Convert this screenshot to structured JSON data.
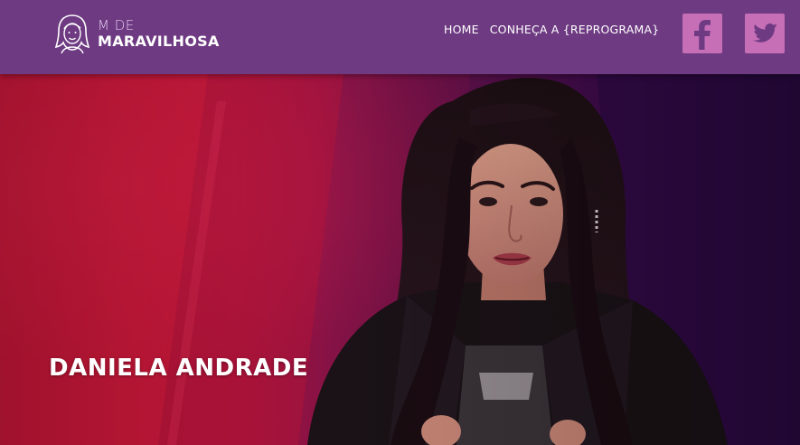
{
  "brand": {
    "line1": "M DE",
    "line2": "MARAVILHOSA",
    "logo_icon": "woman-face-logo-icon"
  },
  "nav": {
    "items": [
      {
        "label": "HOME"
      },
      {
        "label": "CONHEÇA A {REPROGRAMA}"
      }
    ]
  },
  "social": {
    "facebook_icon": "facebook-icon",
    "twitter_icon": "twitter-icon",
    "color": "#c66fb7"
  },
  "hero": {
    "name": "DANIELA ANDRADE",
    "image": "photo of woman speaking"
  },
  "colors": {
    "header_bg": "#6e3a82",
    "hero_red": "#c31535",
    "hero_purple": "#3e0a4c"
  }
}
